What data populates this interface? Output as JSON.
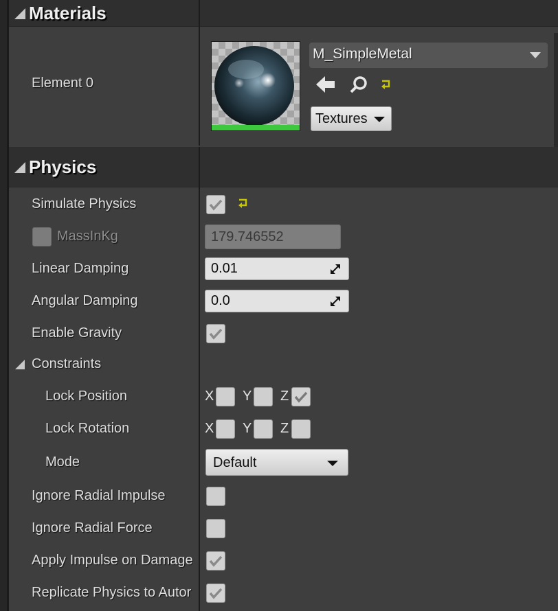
{
  "materials": {
    "title": "Materials",
    "element_label": "Element 0",
    "material_name": "M_SimpleMetal",
    "textures_label": "Textures",
    "icons": [
      "back-arrow-icon",
      "search-icon",
      "reset-to-default-icon"
    ]
  },
  "physics": {
    "title": "Physics",
    "simulate_physics": {
      "label": "Simulate Physics",
      "checked": true
    },
    "mass": {
      "label": "MassInKg",
      "value": "179.746552",
      "enabled": false
    },
    "linear_damping": {
      "label": "Linear Damping",
      "value": "0.01"
    },
    "angular_damping": {
      "label": "Angular Damping",
      "value": "0.0"
    },
    "enable_gravity": {
      "label": "Enable Gravity",
      "checked": true
    },
    "constraints": {
      "label": "Constraints",
      "lock_position": {
        "label": "Lock Position",
        "x": false,
        "y": false,
        "z": true
      },
      "lock_rotation": {
        "label": "Lock Rotation",
        "x": false,
        "y": false,
        "z": false
      },
      "axis_x": "X",
      "axis_y": "Y",
      "axis_z": "Z",
      "mode": {
        "label": "Mode",
        "value": "Default"
      }
    },
    "ignore_radial_impulse": {
      "label": "Ignore Radial Impulse",
      "checked": false
    },
    "ignore_radial_force": {
      "label": "Ignore Radial Force",
      "checked": false
    },
    "apply_impulse_on_damage": {
      "label": "Apply Impulse on Damage",
      "checked": true
    },
    "replicate_physics": {
      "label": "Replicate Physics to Autor",
      "checked": true
    }
  },
  "colors": {
    "panel_bg": "#3e3e3e",
    "header_bg": "#2f2f2f",
    "reset_arrow": "#c8c800",
    "thumbnail_underline": "#3ec83e"
  }
}
